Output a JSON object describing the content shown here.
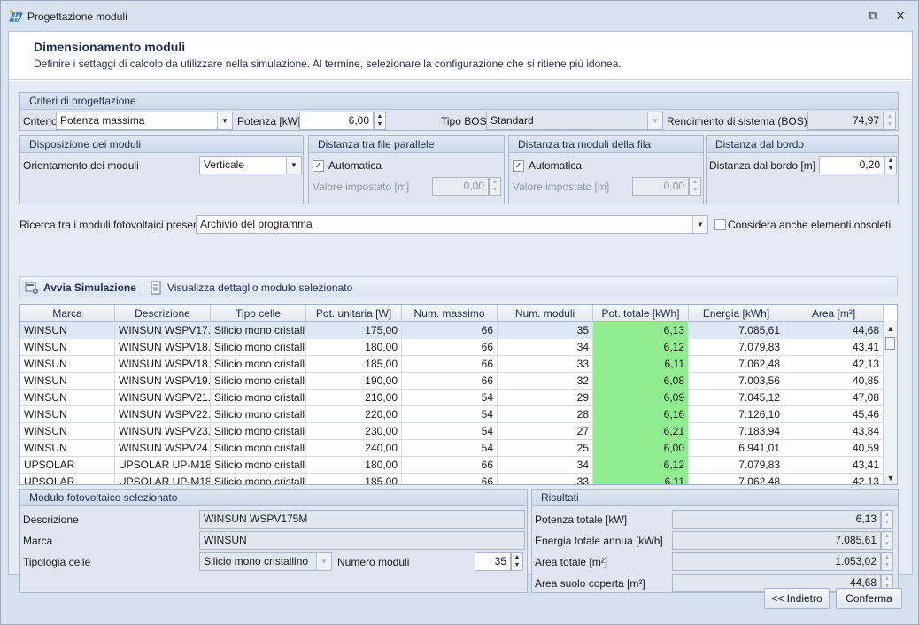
{
  "window": {
    "title": "Progettazione moduli",
    "restore_glyph": "⧉",
    "close_glyph": "✕"
  },
  "header": {
    "title": "Dimensionamento moduli",
    "subtitle": "Definire i settaggi di calcolo da utilizzare nella simulazione. Al termine, selezionare la configurazione che si ritiene più idonea."
  },
  "criteri": {
    "header": "Criteri di progettazione",
    "criterio_label": "Criterio",
    "criterio_value": "Potenza massima",
    "potenza_label": "Potenza [kW]",
    "potenza_value": "6,00",
    "tipo_bos_label": "Tipo BOS",
    "tipo_bos_value": "Standard",
    "rendimento_label": "Rendimento di sistema (BOS) [%]",
    "rendimento_value": "74,97"
  },
  "disposizione": {
    "header": "Disposizione dei moduli",
    "orientamento_label": "Orientamento dei moduli",
    "orientamento_value": "Verticale"
  },
  "distanza_file": {
    "header": "Distanza tra file parallele",
    "auto_label": "Automatica",
    "valore_label": "Valore impostato [m]",
    "valore_value": "0,00"
  },
  "distanza_moduli": {
    "header": "Distanza tra moduli della fila",
    "auto_label": "Automatica",
    "valore_label": "Valore impostato [m]",
    "valore_value": "0,00"
  },
  "distanza_bordo": {
    "header": "Distanza dal bordo",
    "label": "Distanza dal bordo [m]",
    "value": "0,20"
  },
  "ricerca": {
    "label": "Ricerca tra i moduli fotovoltaici presenti in",
    "value": "Archivio del programma",
    "obsoleti_label": "Considera anche elementi obsoleti"
  },
  "toolbar": {
    "avvia_label": "Avvia Simulazione",
    "dettaglio_label": "Visualizza dettaglio modulo selezionato"
  },
  "grid": {
    "columns": [
      "Marca",
      "Descrizione",
      "Tipo celle",
      "Pot. unitaria [W]",
      "Num. massimo",
      "Num. moduli",
      "Pot. totale [kWh]",
      "Energia [kWh]",
      "Area [m²]"
    ],
    "rows": [
      [
        "WINSUN",
        "WINSUN WSPV17...",
        "Silicio mono cristalli...",
        "175,00",
        "66",
        "35",
        "6,13",
        "7.085,61",
        "44,68"
      ],
      [
        "WINSUN",
        "WINSUN WSPV18...",
        "Silicio mono cristalli...",
        "180,00",
        "66",
        "34",
        "6,12",
        "7.079,83",
        "43,41"
      ],
      [
        "WINSUN",
        "WINSUN WSPV18...",
        "Silicio mono cristalli...",
        "185,00",
        "66",
        "33",
        "6,11",
        "7.062,48",
        "42,13"
      ],
      [
        "WINSUN",
        "WINSUN WSPV19...",
        "Silicio mono cristalli...",
        "190,00",
        "66",
        "32",
        "6,08",
        "7.003,56",
        "40,85"
      ],
      [
        "WINSUN",
        "WINSUN WSPV21...",
        "Silicio mono cristalli...",
        "210,00",
        "54",
        "29",
        "6,09",
        "7.045,12",
        "47,08"
      ],
      [
        "WINSUN",
        "WINSUN WSPV22...",
        "Silicio mono cristalli...",
        "220,00",
        "54",
        "28",
        "6,16",
        "7.126,10",
        "45,46"
      ],
      [
        "WINSUN",
        "WINSUN WSPV23...",
        "Silicio mono cristalli...",
        "230,00",
        "54",
        "27",
        "6,21",
        "7.183,94",
        "43,84"
      ],
      [
        "WINSUN",
        "WINSUN WSPV24...",
        "Silicio mono cristalli...",
        "240,00",
        "54",
        "25",
        "6,00",
        "6.941,01",
        "40,59"
      ],
      [
        "UPSOLAR",
        "UPSOLAR UP-M18...",
        "Silicio mono cristalli...",
        "180,00",
        "66",
        "34",
        "6,12",
        "7.079,83",
        "43,41"
      ],
      [
        "UPSOLAR",
        "UPSOLAR UP-M18...",
        "Silicio mono cristalli...",
        "185,00",
        "66",
        "33",
        "6,11",
        "7.062,48",
        "42,13"
      ]
    ]
  },
  "modulo": {
    "header": "Modulo fotovoltaico selezionato",
    "descrizione_label": "Descrizione",
    "descrizione_value": "WINSUN WSPV175M",
    "marca_label": "Marca",
    "marca_value": "WINSUN",
    "tipologia_label": "Tipologia celle",
    "tipologia_value": "Silicio mono cristallino",
    "numero_label": "Numero moduli",
    "numero_value": "35"
  },
  "risultati": {
    "header": "Risultati",
    "potenza_label": "Potenza totale [kW]",
    "potenza_value": "6,13",
    "energia_label": "Energia totale annua [kWh]",
    "energia_value": "7.085,61",
    "area_label": "Area totale [m²]",
    "area_value": "1.053,02",
    "suolo_label": "Area suolo coperta [m²]",
    "suolo_value": "44,68"
  },
  "footer": {
    "indietro_label": "<< Indietro",
    "conferma_label": "Conferma"
  },
  "colors": {
    "highlight_green": "#90ee90",
    "header_text": "#1d2e4d"
  }
}
